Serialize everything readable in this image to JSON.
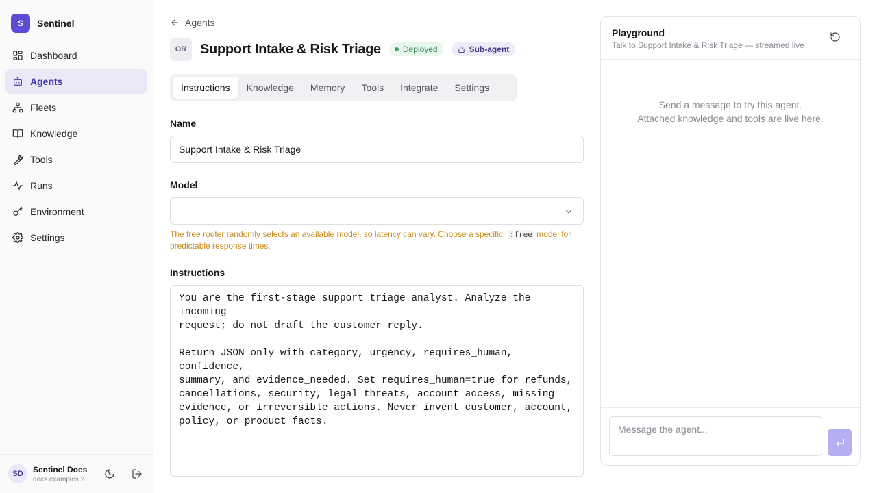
{
  "brand": {
    "logo_letter": "S",
    "name": "Sentinel",
    "accent": "#5b4bd6"
  },
  "sidebar": {
    "items": [
      {
        "label": "Dashboard",
        "icon": "dashboard-icon"
      },
      {
        "label": "Agents",
        "icon": "bot-icon",
        "active": true
      },
      {
        "label": "Fleets",
        "icon": "network-icon"
      },
      {
        "label": "Knowledge",
        "icon": "book-icon"
      },
      {
        "label": "Tools",
        "icon": "wrench-icon"
      },
      {
        "label": "Runs",
        "icon": "activity-icon"
      },
      {
        "label": "Environment",
        "icon": "key-icon"
      },
      {
        "label": "Settings",
        "icon": "gear-icon"
      }
    ]
  },
  "user": {
    "initials": "SD",
    "name": "Sentinel Docs",
    "email": "docs.examples.2..."
  },
  "header": {
    "back_label": "Agents",
    "avatar": "OR",
    "title": "Support Intake & Risk Triage",
    "status": "Deployed",
    "status_color": "#2f8a56",
    "type_badge": "Sub-agent"
  },
  "tabs": [
    {
      "label": "Instructions",
      "active": true
    },
    {
      "label": "Knowledge"
    },
    {
      "label": "Memory"
    },
    {
      "label": "Tools"
    },
    {
      "label": "Integrate"
    },
    {
      "label": "Settings"
    }
  ],
  "form": {
    "name_label": "Name",
    "name_value": "Support Intake & Risk Triage",
    "model_label": "Model",
    "model_value": "",
    "warning_text": "The free router randomly selects an available model, so latency can vary. Choose a specific",
    "warning_code": ":free",
    "warning_tail": "model for predictable response times.",
    "warning_color": "#c98a1b",
    "instructions_label": "Instructions",
    "instructions_value": "You are the first-stage support triage analyst. Analyze the incoming\nrequest; do not draft the customer reply.\n\nReturn JSON only with category, urgency, requires_human, confidence,\nsummary, and evidence_needed. Set requires_human=true for refunds,\ncancellations, security, legal threats, account access, missing\nevidence, or irreversible actions. Never invent customer, account,\npolicy, or product facts."
  },
  "playground": {
    "title": "Playground",
    "subtitle": "Talk to Support Intake & Risk Triage — streamed live",
    "empty_line1": "Send a message to try this agent.",
    "empty_line2": "Attached knowledge and tools are live here.",
    "input_placeholder": "Message the agent..."
  }
}
